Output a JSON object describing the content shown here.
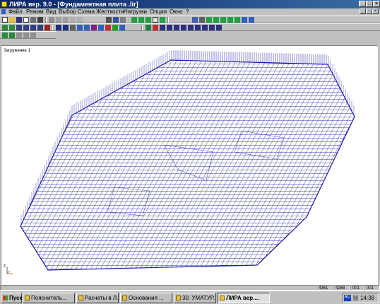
{
  "window": {
    "title": "ЛИРА  вер. 9.0 - [Фундаментная плита .lir]",
    "minimize": "_",
    "maximize": "□",
    "close": "×"
  },
  "menu": [
    "Файл",
    "Режим",
    "Вид",
    "Выбор",
    "Схема",
    "Жесткости",
    "Нагрузки",
    "Опции",
    "Окно",
    "?"
  ],
  "canvas": {
    "load_label": "Загружение 1",
    "mesh_color": "#1a1aa8",
    "axis_label": "Z"
  },
  "status": {
    "values": [
      "4361",
      "4288",
      "001",
      "001"
    ]
  },
  "taskbar": {
    "start": "Пуск",
    "tasks": [
      "Пояснитель...",
      "Расчеты в Л...",
      "Основания ...",
      "30. УМАТУР...",
      "ЛИРА  вер...."
    ],
    "active_index": 4,
    "tray_lang": "RU",
    "clock": "14:38"
  }
}
